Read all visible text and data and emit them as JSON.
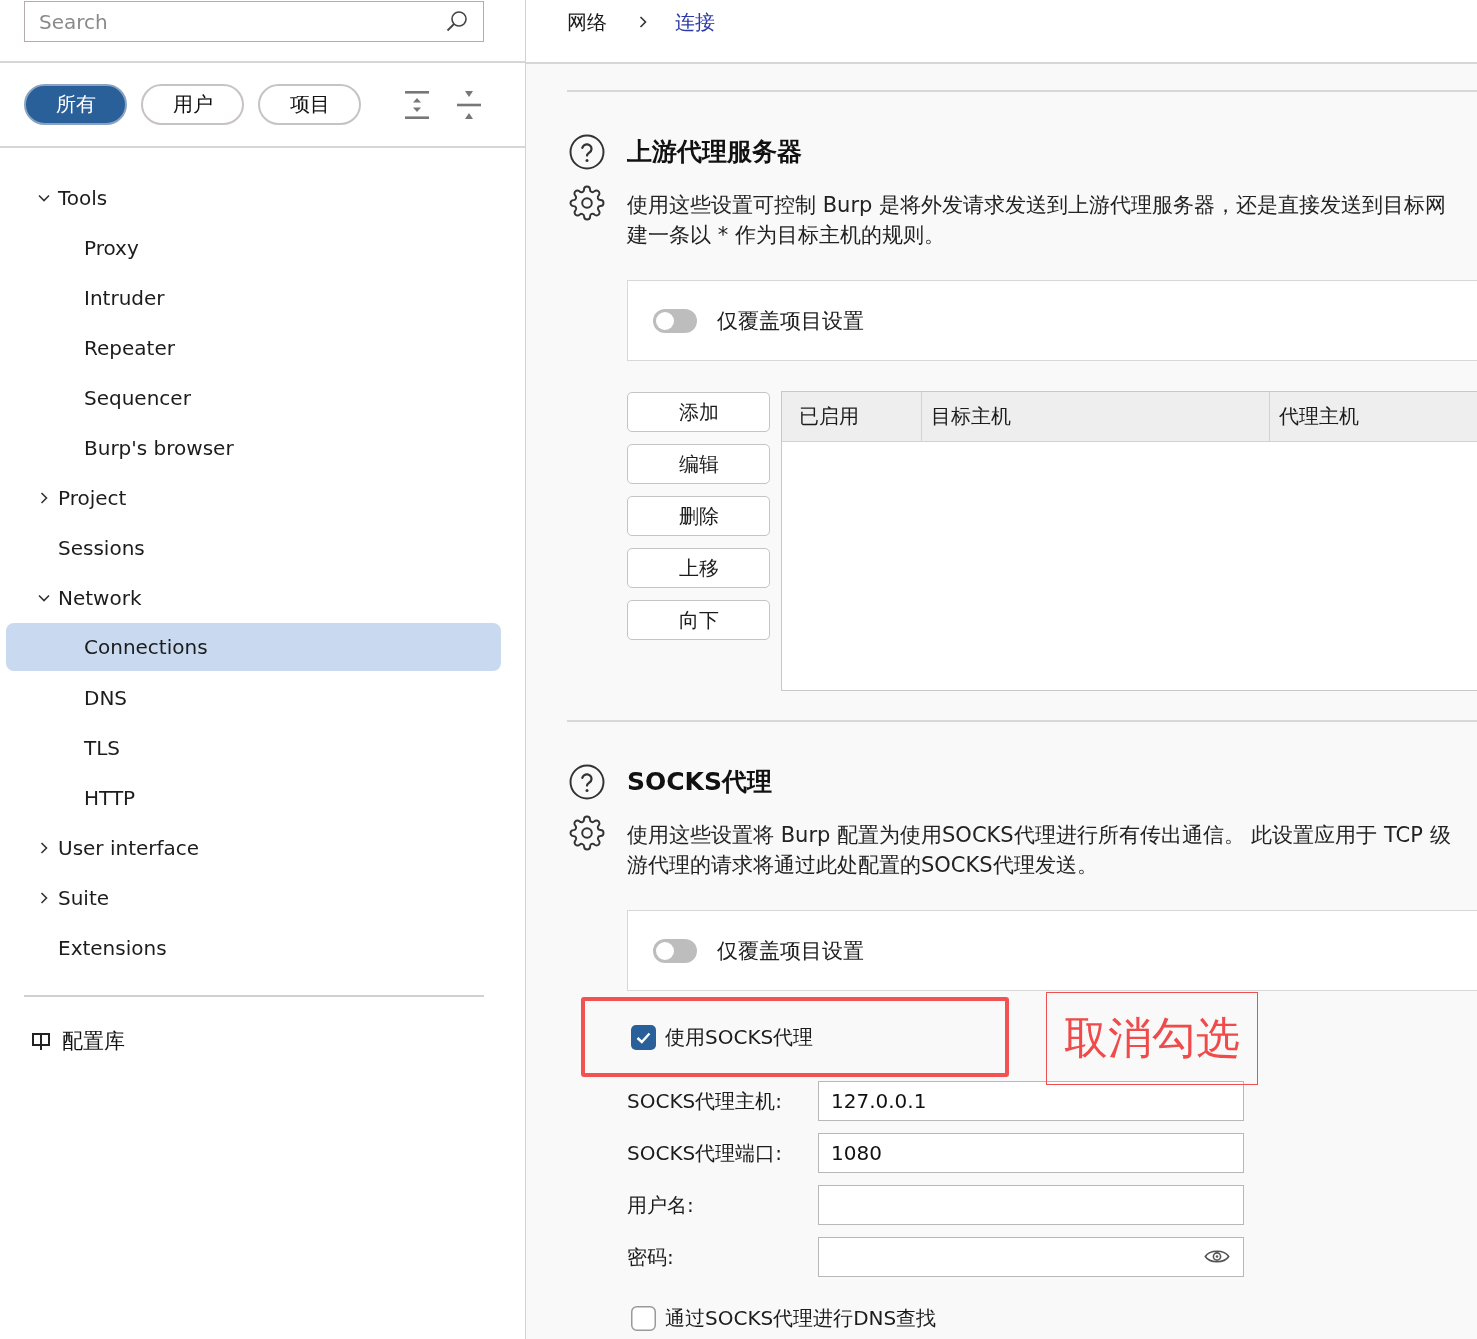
{
  "sidebar": {
    "search": {
      "placeholder": "Search"
    },
    "filters": [
      {
        "label": "所有",
        "selected": true
      },
      {
        "label": "用户",
        "selected": false
      },
      {
        "label": "项目",
        "selected": false
      }
    ],
    "tree": [
      {
        "label": "Tools",
        "kind": "group",
        "expanded": true,
        "selected": false,
        "children": [
          {
            "label": "Proxy",
            "selected": false
          },
          {
            "label": "Intruder",
            "selected": false
          },
          {
            "label": "Repeater",
            "selected": false
          },
          {
            "label": "Sequencer",
            "selected": false
          },
          {
            "label": "Burp's browser",
            "selected": false
          }
        ]
      },
      {
        "label": "Project",
        "kind": "group",
        "expanded": false,
        "selected": false
      },
      {
        "label": "Sessions",
        "kind": "page",
        "selected": false
      },
      {
        "label": "Network",
        "kind": "group",
        "expanded": true,
        "selected": false,
        "children": [
          {
            "label": "Connections",
            "selected": true
          },
          {
            "label": "DNS",
            "selected": false
          },
          {
            "label": "TLS",
            "selected": false
          },
          {
            "label": "HTTP",
            "selected": false
          }
        ]
      },
      {
        "label": "User interface",
        "kind": "group",
        "expanded": false,
        "selected": false
      },
      {
        "label": "Suite",
        "kind": "group",
        "expanded": false,
        "selected": false
      },
      {
        "label": "Extensions",
        "kind": "page",
        "selected": false
      }
    ],
    "library_link": "配置库"
  },
  "breadcrumb": [
    {
      "label": "网络",
      "kind": "text"
    },
    {
      "label": "连接",
      "kind": "link"
    }
  ],
  "sections": [
    {
      "kind": "upstream",
      "title": "上游代理服务器",
      "description": [
        "使用这些设置可控制 Burp 是将外发请求发送到上游代理服务器，还是直接发送到目标网",
        "建一条以 * 作为目标主机的规则。"
      ],
      "override": {
        "label": "仅覆盖项目设置",
        "on": false
      },
      "buttons": [
        "添加",
        "编辑",
        "删除",
        "上移",
        "向下"
      ],
      "table": {
        "columns": [
          "已启用",
          "目标主机",
          "代理主机"
        ]
      }
    },
    {
      "kind": "socks",
      "title": "SOCKS代理",
      "description": [
        "使用这些设置将 Burp 配置为使用SOCKS代理进行所有传出通信。 此设置应用于 TCP 级",
        "游代理的请求将通过此处配置的SOCKS代理发送。"
      ],
      "override": {
        "label": "仅覆盖项目设置",
        "on": false
      },
      "use_socks": {
        "label": "使用SOCKS代理",
        "checked": true,
        "highlighted": true
      },
      "annotation": "取消勾选",
      "fields": [
        {
          "label": "SOCKS代理主机:",
          "kind": "text",
          "value": "127.0.0.1"
        },
        {
          "label": "SOCKS代理端口:",
          "kind": "text",
          "value": "1080"
        },
        {
          "label": "用户名:",
          "kind": "text"
        },
        {
          "label": "密码:",
          "kind": "password"
        }
      ],
      "dns_lookup": {
        "label": "通过SOCKS代理进行DNS查找",
        "checked": false
      }
    }
  ]
}
